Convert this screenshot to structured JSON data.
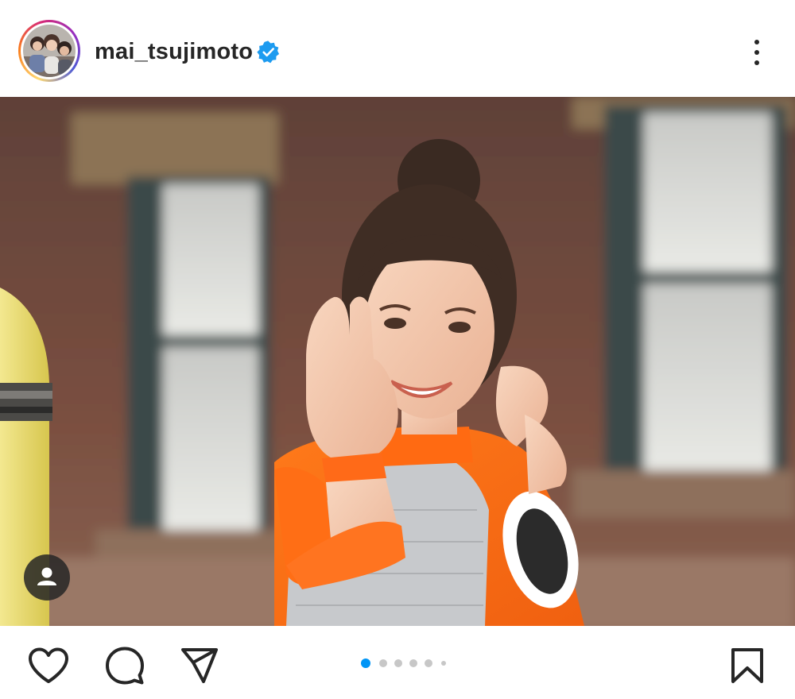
{
  "post": {
    "username": "mai_tsujimoto",
    "verified": true
  },
  "icons": {
    "verified": "verified-badge-icon",
    "more": "more-options-icon",
    "user_tag": "user-tag-icon",
    "like": "heart-icon",
    "comment": "comment-icon",
    "share": "send-icon",
    "save": "bookmark-icon"
  },
  "carousel": {
    "total": 6,
    "current": 1
  },
  "colors": {
    "accent": "#0095f6",
    "text": "#262626",
    "inactive_dot": "#c7c7c7"
  }
}
